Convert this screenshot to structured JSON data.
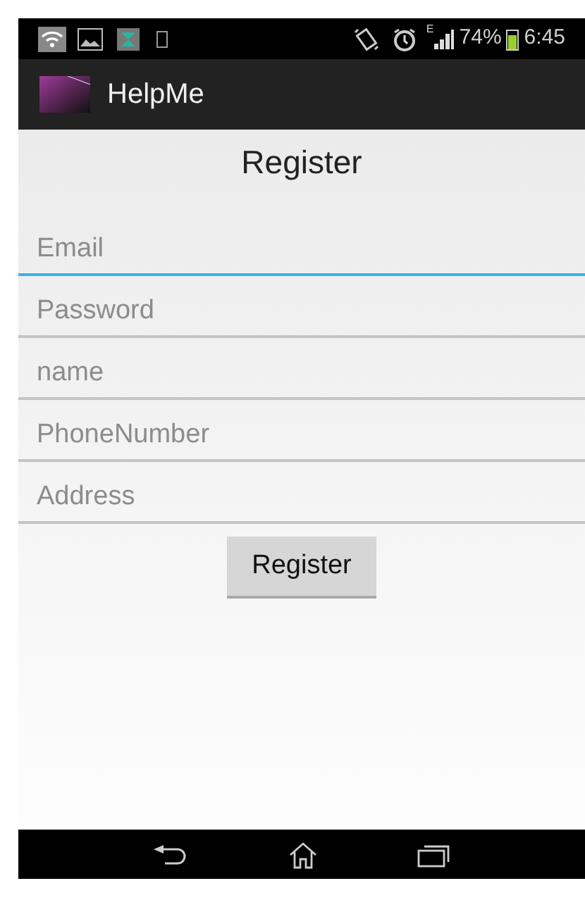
{
  "status_bar": {
    "battery": "74%",
    "time": "6:45",
    "network_type": "E"
  },
  "action_bar": {
    "title": "HelpMe"
  },
  "heading": "Register",
  "fields": [
    {
      "placeholder": "Email",
      "focused": true
    },
    {
      "placeholder": "Password",
      "focused": false
    },
    {
      "placeholder": "name",
      "focused": false
    },
    {
      "placeholder": "PhoneNumber",
      "focused": false
    },
    {
      "placeholder": "Address",
      "focused": false
    }
  ],
  "button": "Register"
}
